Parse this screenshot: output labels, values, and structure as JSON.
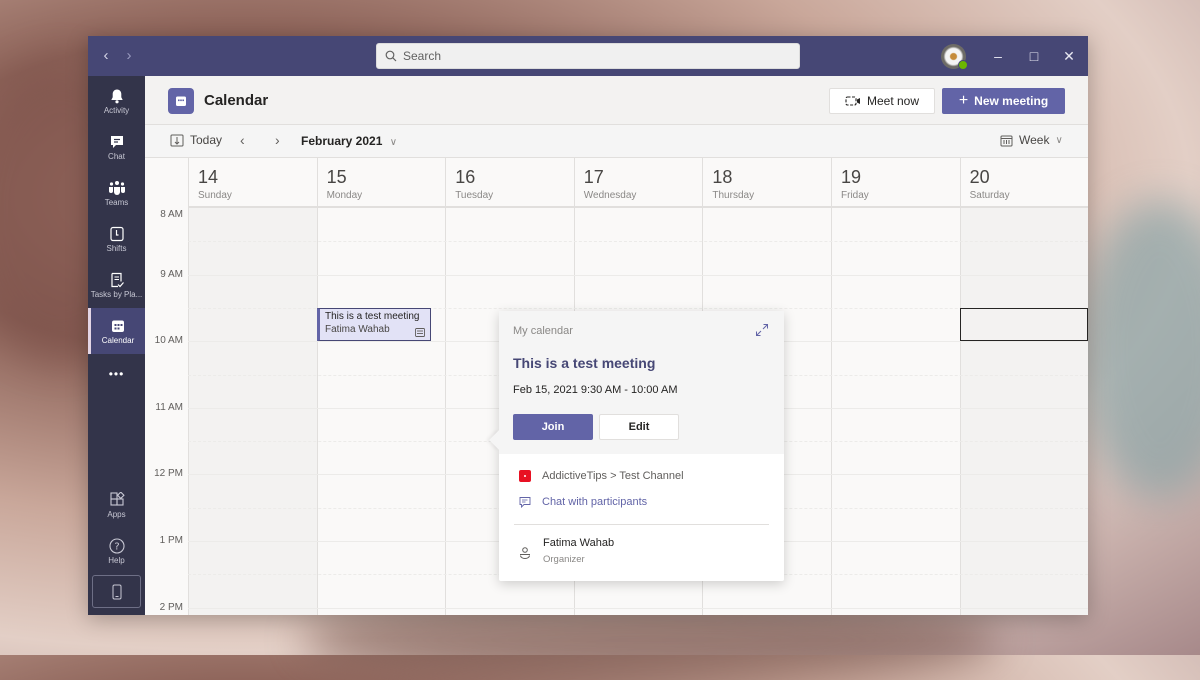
{
  "titlebar": {
    "search_placeholder": "Search",
    "back_icon": "chevron-left-icon",
    "forward_icon": "chevron-right-icon",
    "window_controls": [
      "minimize",
      "maximize",
      "close"
    ]
  },
  "sidebar": {
    "items": [
      {
        "label": "Activity",
        "icon": "bell-icon"
      },
      {
        "label": "Chat",
        "icon": "chat-icon"
      },
      {
        "label": "Teams",
        "icon": "teams-icon"
      },
      {
        "label": "Shifts",
        "icon": "clock-icon"
      },
      {
        "label": "Tasks by Pla...",
        "icon": "tasks-icon"
      },
      {
        "label": "Calendar",
        "icon": "calendar-icon",
        "active": true
      },
      {
        "label": "",
        "icon": "more-icon"
      }
    ],
    "more_label": "•••",
    "bottom_items": [
      {
        "label": "Apps",
        "icon": "apps-icon"
      },
      {
        "label": "Help",
        "icon": "help-icon"
      }
    ]
  },
  "header": {
    "title": "Calendar",
    "meet_now_label": "Meet now",
    "new_meeting_label": "New meeting",
    "accent_color": "#6264a7"
  },
  "toolbar": {
    "today_label": "Today",
    "month_label": "February 2021",
    "view_label": "Week"
  },
  "week": {
    "days": [
      {
        "num": "14",
        "name": "Sunday"
      },
      {
        "num": "15",
        "name": "Monday"
      },
      {
        "num": "16",
        "name": "Tuesday"
      },
      {
        "num": "17",
        "name": "Wednesday"
      },
      {
        "num": "18",
        "name": "Thursday"
      },
      {
        "num": "19",
        "name": "Friday"
      },
      {
        "num": "20",
        "name": "Saturday"
      }
    ],
    "hours": [
      "8 AM",
      "9 AM",
      "10 AM",
      "11 AM",
      "12 PM",
      "1 PM",
      "2 PM"
    ]
  },
  "event": {
    "title": "This is a test meeting",
    "organizer": "Fatima Wahab"
  },
  "popup": {
    "calendar_label": "My calendar",
    "title": "This is a test meeting",
    "datetime": "Feb 15, 2021 9:30 AM - 10:00 AM",
    "join_label": "Join",
    "edit_label": "Edit",
    "channel": "AddictiveTips > Test Channel",
    "chat_label": "Chat with participants",
    "organizer_name": "Fatima Wahab",
    "organizer_role": "Organizer",
    "channel_color": "#e81123"
  }
}
